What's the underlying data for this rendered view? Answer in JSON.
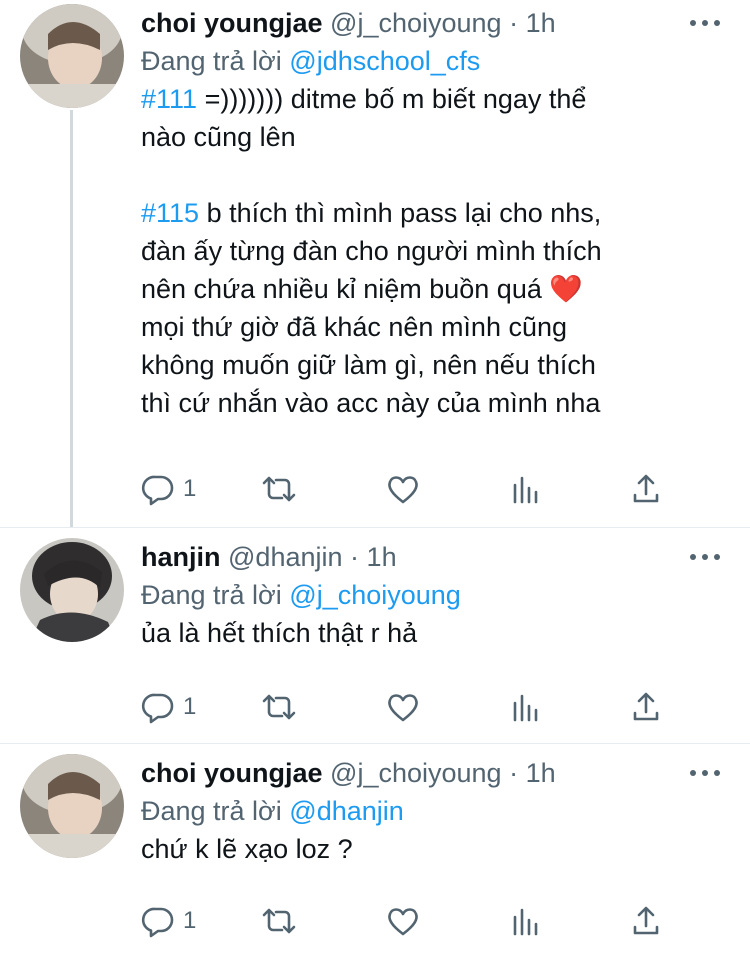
{
  "tweets": [
    {
      "name": "choi youngjae",
      "handle": "@j_choiyoung",
      "separator": "·",
      "time": "1h",
      "replying_prefix": "Đang trả lời",
      "replying_to": "@jdhschool_cfs",
      "line1_tag": "#111",
      "line1_rest": " =))))))) ditme bố m biết ngay thể",
      "line2": "nào cũng lên",
      "line4_tag": "#115",
      "line4_rest": " b thích thì mình pass lại cho nhs,",
      "line5": "đàn ấy từng đàn cho người mình thích",
      "line6": "nên chứa nhiều kỉ niệm buồn quá ",
      "heart_emoji": "❤️",
      "line7": "mọi thứ giờ đã khác nên mình cũng",
      "line8": "không muốn giữ làm gì, nên nếu thích",
      "line9": "thì cứ nhắn vào acc này của mình nha",
      "reply_count": "1"
    },
    {
      "name": "hanjin",
      "handle": "@dhanjin",
      "separator": "·",
      "time": "1h",
      "replying_prefix": "Đang trả lời",
      "replying_to": "@j_choiyoung",
      "text": "ủa là hết thích thật r hả",
      "reply_count": "1"
    },
    {
      "name": "choi youngjae",
      "handle": "@j_choiyoung",
      "separator": "·",
      "time": "1h",
      "replying_prefix": "Đang trả lời",
      "replying_to": "@dhanjin",
      "text": "chứ k lẽ xạo loz ?",
      "reply_count": "1"
    }
  ],
  "icons": {
    "reply": "reply-icon",
    "retweet": "retweet-icon",
    "like": "heart-icon",
    "analytics": "analytics-icon",
    "share": "share-icon",
    "more": "more-icon"
  },
  "colors": {
    "link": "#1d9bf0",
    "secondary_text": "#536471",
    "thread_line": "#cfd9de",
    "divider": "#e6ecf0"
  }
}
